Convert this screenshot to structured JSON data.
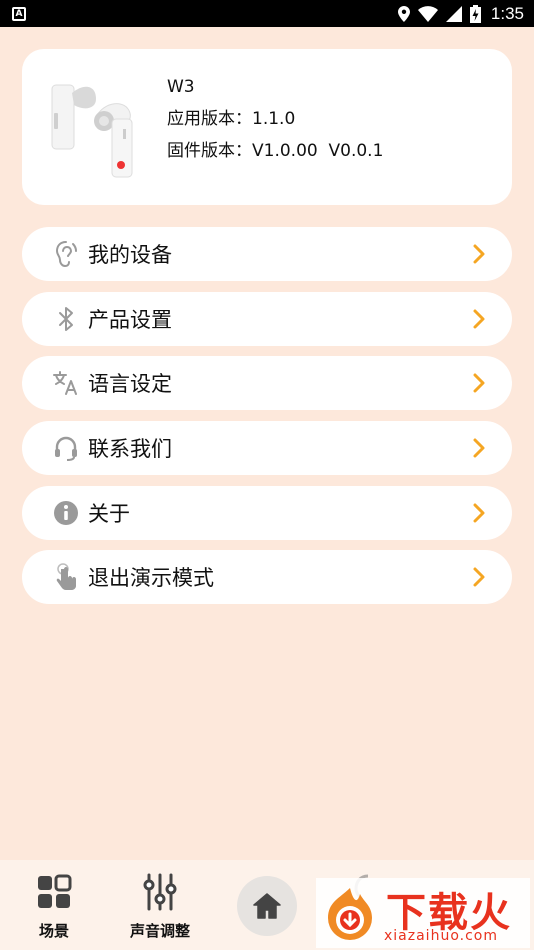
{
  "status_bar": {
    "time": "1:35",
    "app_icon": "A",
    "icons": [
      "location-icon",
      "wifi-icon",
      "signal-icon",
      "battery-charging-icon"
    ]
  },
  "device": {
    "name": "W3",
    "app_version_label": "应用版本：",
    "app_version": "1.1.0",
    "firmware_label": "固件版本：",
    "firmware_version": "V1.0.00  V0.0.1",
    "image_icon": "earbuds-image"
  },
  "menu": [
    {
      "label": "我的设备",
      "icon": "ear-icon"
    },
    {
      "label": "产品设置",
      "icon": "bluetooth-icon"
    },
    {
      "label": "语言设定",
      "icon": "translate-icon"
    },
    {
      "label": "联系我们",
      "icon": "headset-icon"
    },
    {
      "label": "关于",
      "icon": "info-icon"
    },
    {
      "label": "退出演示模式",
      "icon": "touch-icon"
    }
  ],
  "bottom_nav": {
    "items": [
      {
        "label": "场景",
        "icon": "grid-icon"
      },
      {
        "label": "声音调整",
        "icon": "sliders-icon"
      },
      {
        "label": "",
        "icon": "home-icon"
      }
    ]
  },
  "watermark": {
    "title": "下载火",
    "subtitle": "xiazaihuo.com"
  },
  "colors": {
    "background": "#fde8db",
    "card": "#ffffff",
    "accent": "#f5a623",
    "icon_gray": "#9a9a9a",
    "watermark_red": "#e8321e"
  }
}
